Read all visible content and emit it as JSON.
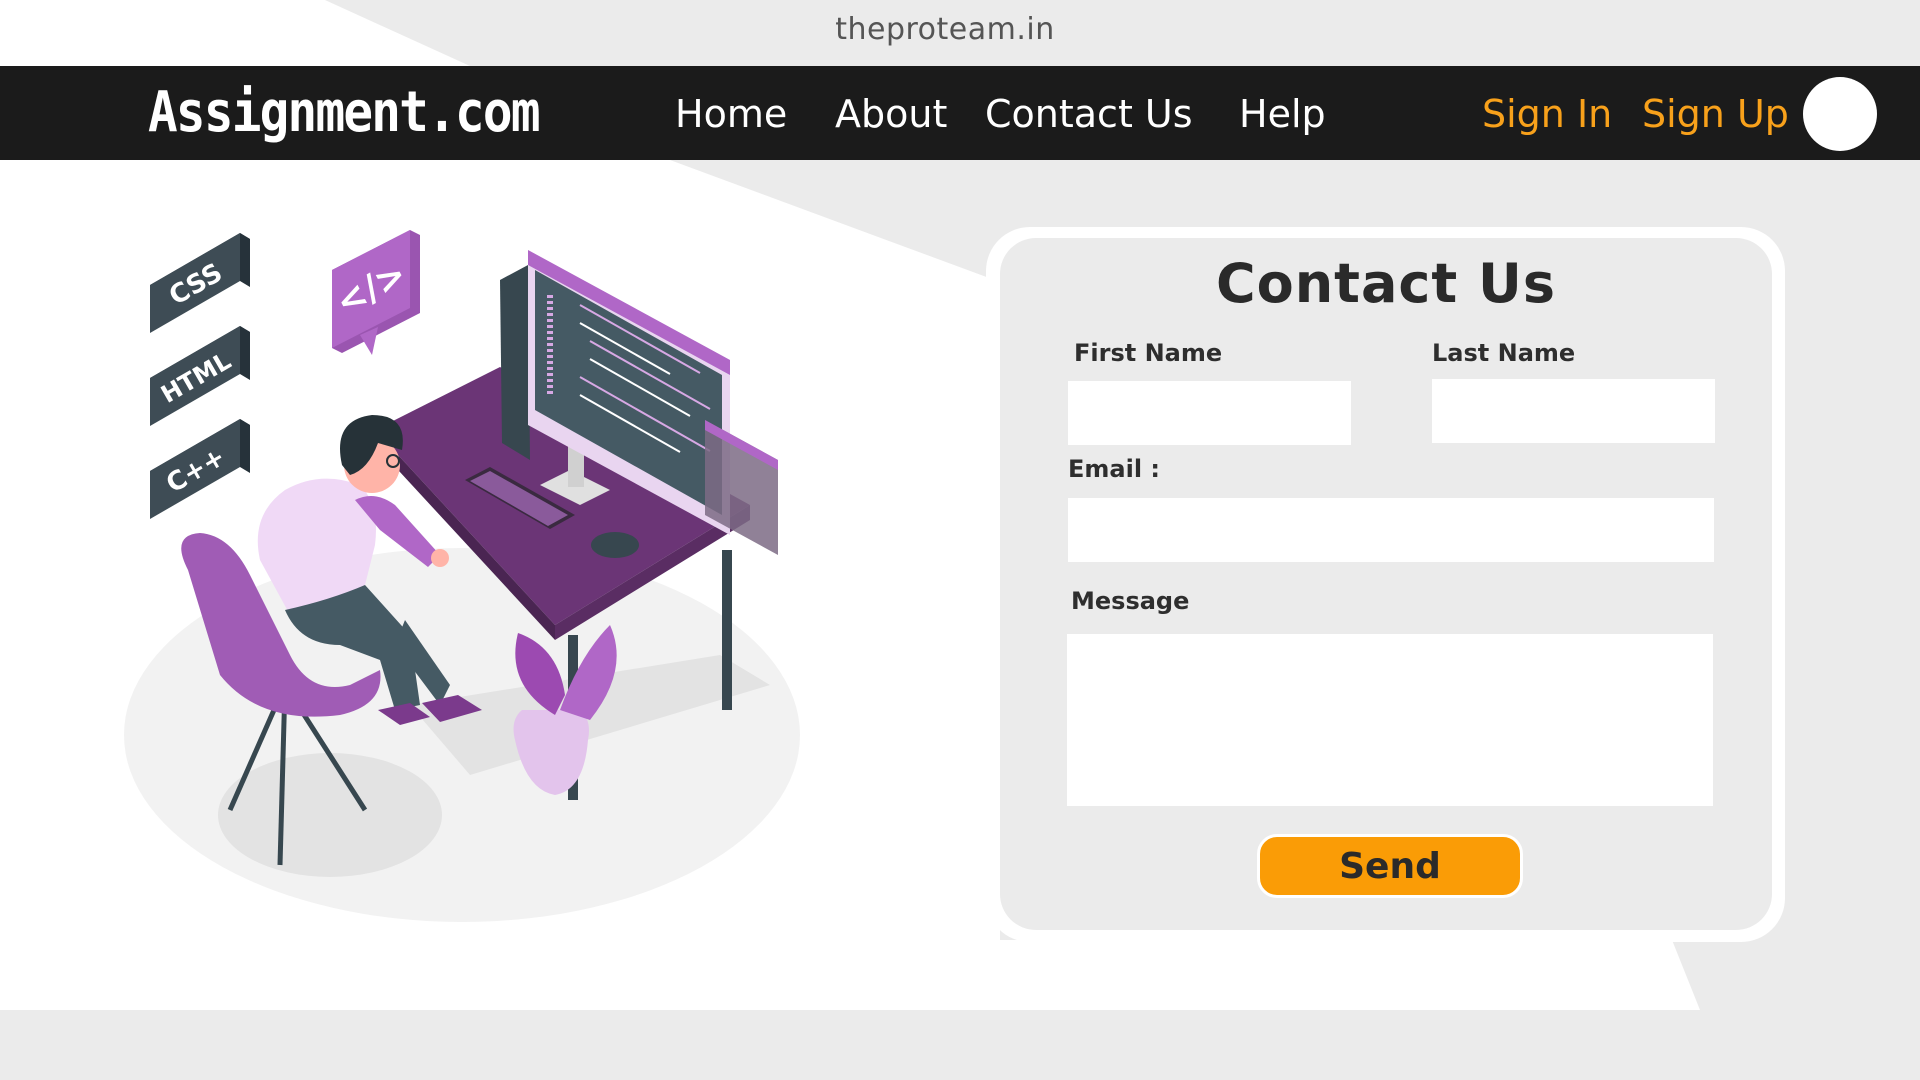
{
  "watermark": "theproteam.in",
  "navbar": {
    "logo": "Assignment.com",
    "links": [
      "Home",
      "About",
      "Contact Us",
      "Help"
    ],
    "sign_in": "Sign In",
    "sign_up": "Sign Up"
  },
  "illustration": {
    "badges": [
      "CSS",
      "HTML",
      "C++"
    ],
    "code_bubble": "</>"
  },
  "form": {
    "title": "Contact Us",
    "first_name_label": "First Name",
    "last_name_label": "Last Name",
    "email_label": "Email :",
    "message_label": "Message",
    "first_name_value": "",
    "last_name_value": "",
    "email_value": "",
    "message_value": "",
    "send_label": "Send"
  },
  "colors": {
    "navbar": "#1b1b1b",
    "accent": "#f8a11b",
    "button": "#fa9c06",
    "illustration_purple": "#b067c7",
    "page_bg": "#ebebeb"
  }
}
